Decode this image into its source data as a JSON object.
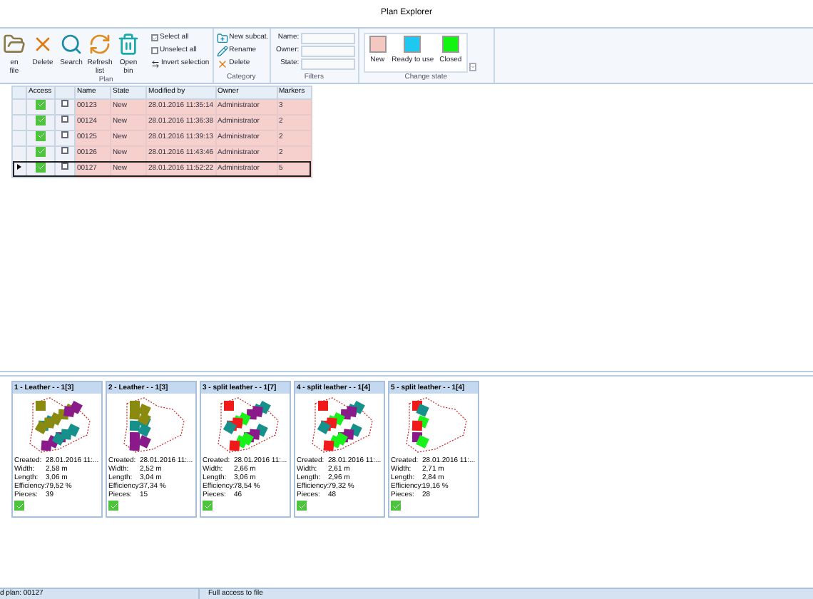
{
  "window": {
    "title": "Plan Explorer"
  },
  "ribbon": {
    "plan": {
      "label": "Plan",
      "buttons": [
        {
          "kind": "open",
          "label": "en",
          "label2": "file"
        },
        {
          "kind": "delete",
          "label": "Delete"
        },
        {
          "kind": "search",
          "label": "Search"
        },
        {
          "kind": "refresh",
          "label": "Refresh",
          "label2": "list"
        },
        {
          "kind": "bin",
          "label": "Open",
          "label2": "bin"
        }
      ],
      "selection": [
        {
          "kind": "check",
          "label": "Select all",
          "checked": true
        },
        {
          "kind": "check",
          "label": "Unselect all",
          "checked": false
        },
        {
          "kind": "invert",
          "label": "Invert selection"
        }
      ]
    },
    "category": {
      "label": "Category",
      "items": [
        {
          "kind": "new",
          "label": "New subcat."
        },
        {
          "kind": "rename",
          "label": "Rename"
        },
        {
          "kind": "delete",
          "label": "Delete"
        }
      ]
    },
    "filters": {
      "label": "Filters",
      "fields": [
        {
          "label": "Name:"
        },
        {
          "label": "Owner:"
        },
        {
          "label": "State:"
        }
      ]
    },
    "change_state": {
      "label": "Change state",
      "states": [
        {
          "label": "New",
          "color": "#f4c7c0"
        },
        {
          "label": "Ready to use",
          "color": "#1fc8f0"
        },
        {
          "label": "Closed",
          "color": "#11f511"
        }
      ]
    }
  },
  "table": {
    "columns": [
      "Access",
      "",
      "Name",
      "State",
      "Modified by",
      "Owner",
      "Markers"
    ],
    "rows": [
      {
        "name": "00123",
        "state": "New",
        "modified": "28.01.2016 11:35:14",
        "owner": "Administrator",
        "markers": "3",
        "checked": false,
        "selected": false
      },
      {
        "name": "00124",
        "state": "New",
        "modified": "28.01.2016 11:36:38",
        "owner": "Administrator",
        "markers": "2",
        "checked": false,
        "selected": false
      },
      {
        "name": "00125",
        "state": "New",
        "modified": "28.01.2016 11:39:13",
        "owner": "Administrator",
        "markers": "2",
        "checked": false,
        "selected": false
      },
      {
        "name": "00126",
        "state": "New",
        "modified": "28.01.2016 11:43:46",
        "owner": "Administrator",
        "markers": "2",
        "checked": false,
        "selected": false
      },
      {
        "name": "00127",
        "state": "New",
        "modified": "28.01.2016 11:52:22",
        "owner": "Administrator",
        "markers": "5",
        "checked": false,
        "selected": true
      }
    ]
  },
  "markers": [
    {
      "title": "1 - Leather - - 1[3]",
      "fields": [
        {
          "label": "Created:",
          "value": "28.01.2016 11:..."
        },
        {
          "label": "Width:",
          "value": "2,58 m"
        },
        {
          "label": "Length:",
          "value": "3,06 m"
        },
        {
          "label": "Efficiency:",
          "value": "79,52 %"
        },
        {
          "label": "Pieces:",
          "value": "39"
        }
      ]
    },
    {
      "title": "2 - Leather - - 1[3]",
      "fields": [
        {
          "label": "Created:",
          "value": "28.01.2016 11:..."
        },
        {
          "label": "Width:",
          "value": "2,52 m"
        },
        {
          "label": "Length:",
          "value": "3,04 m"
        },
        {
          "label": "Efficiency:",
          "value": "37,34 %"
        },
        {
          "label": "Pieces:",
          "value": "15"
        }
      ]
    },
    {
      "title": "3 - split leather - - 1[7]",
      "fields": [
        {
          "label": "Created:",
          "value": "28.01.2016 11:..."
        },
        {
          "label": "Width:",
          "value": "2,66 m"
        },
        {
          "label": "Length:",
          "value": "3,06 m"
        },
        {
          "label": "Efficiency:",
          "value": "78,54 %"
        },
        {
          "label": "Pieces:",
          "value": "46"
        }
      ]
    },
    {
      "title": "4 - split leather - - 1[4]",
      "fields": [
        {
          "label": "Created:",
          "value": "28.01.2016 11:..."
        },
        {
          "label": "Width:",
          "value": "2,61 m"
        },
        {
          "label": "Length:",
          "value": "2,96 m"
        },
        {
          "label": "Efficiency:",
          "value": "79,32 %"
        },
        {
          "label": "Pieces:",
          "value": "48"
        }
      ]
    },
    {
      "title": "5 - split leather - - 1[4]",
      "fields": [
        {
          "label": "Created:",
          "value": "28.01.2016 11:..."
        },
        {
          "label": "Width:",
          "value": "2,71 m"
        },
        {
          "label": "Length:",
          "value": "2,84 m"
        },
        {
          "label": "Efficiency:",
          "value": "19,16 %"
        },
        {
          "label": "Pieces:",
          "value": "28"
        }
      ]
    }
  ],
  "status_bar": [
    "d plan: 00127",
    "Full access to file"
  ]
}
